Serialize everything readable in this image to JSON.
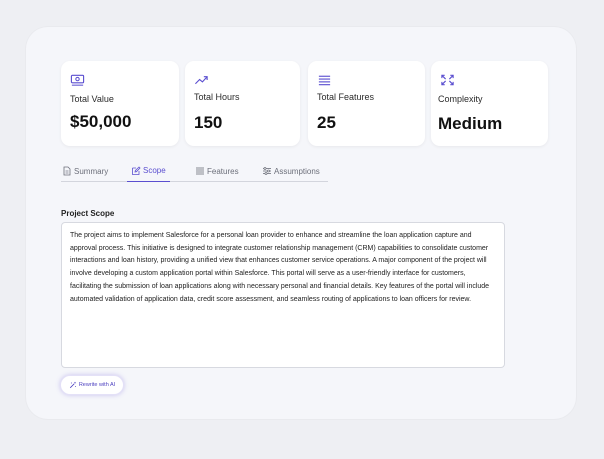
{
  "colors": {
    "accent": "#5b4fd0",
    "background": "#eeeff3",
    "card": "#ffffff"
  },
  "stats": [
    {
      "icon": "money-icon",
      "label": "Total Value",
      "value": "$50,000"
    },
    {
      "icon": "trend-up-icon",
      "label": "Total Hours",
      "value": "150"
    },
    {
      "icon": "list-icon",
      "label": "Total Features",
      "value": "25"
    },
    {
      "icon": "expand-icon",
      "label": "Complexity",
      "value": "Medium"
    }
  ],
  "tabs": [
    {
      "icon": "document-icon",
      "label": "Summary"
    },
    {
      "icon": "edit-icon",
      "label": "Scope",
      "active": true
    },
    {
      "icon": "list-icon",
      "label": "Features"
    },
    {
      "icon": "sliders-icon",
      "label": "Assumptions"
    }
  ],
  "scope": {
    "title": "Project Scope",
    "text": "The project aims to implement Salesforce for a personal loan provider to enhance and streamline the loan application capture and approval process. This initiative is designed to integrate customer relationship management (CRM) capabilities to consolidate customer interactions and loan history, providing a unified view that enhances customer service operations. A major component of the project will involve developing a custom application portal within Salesforce. This portal will serve as a user-friendly interface for customers, facilitating the submission of loan applications along with necessary personal and financial details. Key features of the portal will include automated validation of application data, credit score assessment, and seamless routing of applications to loan officers for review."
  },
  "actions": {
    "rewrite_label": "Rewrite with AI"
  }
}
